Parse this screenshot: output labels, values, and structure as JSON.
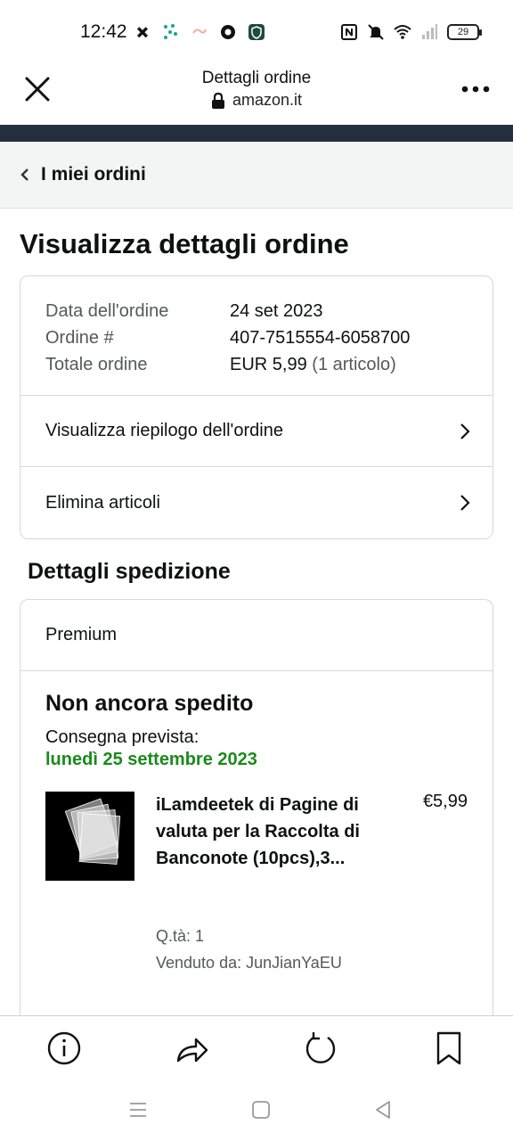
{
  "status_bar": {
    "time": "12:42",
    "battery": "29",
    "icons": [
      "game-controller-icon",
      "dots-icon",
      "link-icon",
      "chrome-icon",
      "shield-app-icon",
      "nfc-icon",
      "mute-icon",
      "wifi-icon",
      "signal-icon"
    ]
  },
  "browser": {
    "title": "Dettagli ordine",
    "url": "amazon.it"
  },
  "breadcrumb": {
    "label": "I miei ordini"
  },
  "page_title": "Visualizza dettagli ordine",
  "order": {
    "date_label": "Data dell'ordine",
    "date_value": "24 set 2023",
    "number_label": "Ordine #",
    "number_value": "407-7515554-6058700",
    "total_label": "Totale ordine",
    "total_value": "EUR 5,99",
    "total_items": "(1 articolo)",
    "summary_link": "Visualizza riepilogo dell'ordine",
    "delete_link": "Elimina articoli"
  },
  "shipping": {
    "section_title": "Dettagli spedizione",
    "type": "Premium",
    "status": "Non ancora spedito",
    "eta_label": "Consegna prevista:",
    "eta_date": "lunedì 25 settembre 2023",
    "item": {
      "title": "iLamdeetek di Pagine di valuta per la Raccolta di Banconote (10pcs),3...",
      "price": "€5,99",
      "qty": "Q.tà: 1",
      "seller": "Venduto da: JunJianYaEU"
    }
  },
  "colors": {
    "header_band": "#232f3e",
    "eta_green": "#1a8a1a",
    "muted": "#565959"
  }
}
